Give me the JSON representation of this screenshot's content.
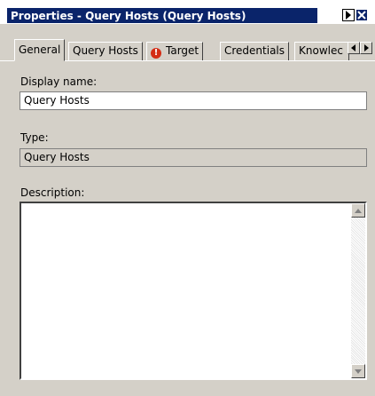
{
  "window": {
    "title": "Properties - Query Hosts (Query Hosts)"
  },
  "tabs": [
    {
      "label": "General",
      "active": true
    },
    {
      "label": "Query Hosts",
      "active": false
    },
    {
      "label": "Target",
      "active": false,
      "icon": "error-icon"
    },
    {
      "label": "Credentials",
      "active": false
    },
    {
      "label": "Knowlec",
      "active": false
    }
  ],
  "form": {
    "display_name_label": "Display name:",
    "display_name_value": "Query Hosts",
    "type_label": "Type:",
    "type_value": "Query Hosts",
    "description_label": "Description:",
    "description_value": ""
  },
  "colors": {
    "titlebar": "#0a246a",
    "dialog_bg": "#d4d0c8",
    "error_icon": "#d42c14"
  }
}
